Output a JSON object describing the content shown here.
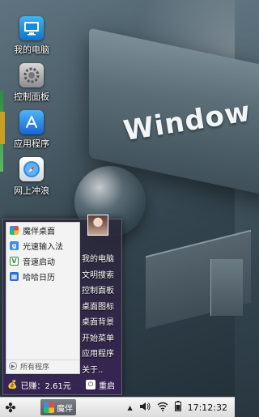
{
  "wallpaper": {
    "text": "Window"
  },
  "desktop_icons": [
    {
      "name": "computer",
      "label": "我的电脑",
      "icon": "computer-icon"
    },
    {
      "name": "control-panel",
      "label": "控制面板",
      "icon": "settings-icon"
    },
    {
      "name": "apps",
      "label": "应用程序",
      "icon": "appstore-icon"
    },
    {
      "name": "browser",
      "label": "网上冲浪",
      "icon": "compass-icon"
    }
  ],
  "start_menu": {
    "pinned": [
      {
        "label": "魔伴桌面",
        "color": "#e94b3c",
        "glyph": ""
      },
      {
        "label": "光速输入法",
        "color": "#3a8ee6",
        "glyph": "g"
      },
      {
        "label": "音速启动",
        "color": "#2e8b3e",
        "glyph": "V"
      },
      {
        "label": "哈哈日历",
        "color": "#2a6fc9",
        "glyph": "▦"
      }
    ],
    "all_programs": "所有程序",
    "right_items": [
      "我的电脑",
      "文明搜索",
      "控制面板",
      "桌面图标",
      "桌面背景",
      "开始菜单",
      "应用程序",
      "关于.."
    ],
    "earned": "已赚：2.61元",
    "restart": "重启"
  },
  "taskbar": {
    "start_icon": "clover-icon",
    "app_label": "魔伴",
    "tray_up": "▲",
    "time": "17:12:32"
  }
}
